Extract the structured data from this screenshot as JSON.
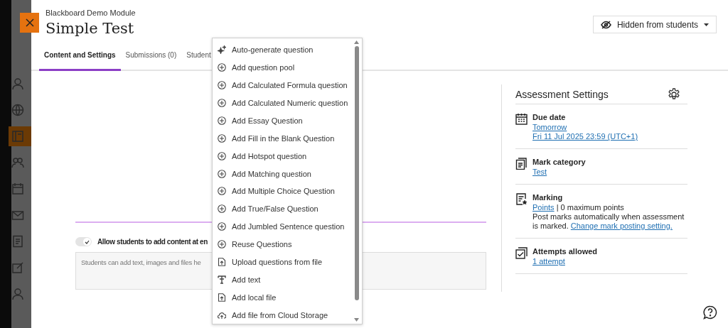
{
  "header": {
    "module": "Blackboard Demo Module",
    "title": "Simple Test",
    "visibility": "Hidden from students"
  },
  "tabs": [
    {
      "label": "Content and Settings",
      "selected": true
    },
    {
      "label": "Submissions (0)",
      "selected": false
    },
    {
      "label": "Student",
      "selected": false
    }
  ],
  "content": {
    "toggle": {
      "label": "Allow students to add content at en",
      "on": true
    },
    "textarea": {
      "placeholder": "Students can add text, images and files he"
    }
  },
  "settings": {
    "title": "Assessment Settings",
    "items": [
      {
        "kind": "calendar",
        "label": "Due date",
        "lines": [
          [
            {
              "text": "Tomorrow",
              "link": true
            }
          ],
          [
            {
              "text": "Fri 11 Jul 2025 23:59 (UTC+1)",
              "link": true
            }
          ]
        ]
      },
      {
        "kind": "category",
        "label": "Mark category",
        "lines": [
          [
            {
              "text": "Test",
              "link": true
            }
          ]
        ]
      },
      {
        "kind": "marking",
        "label": "Marking",
        "lines": [
          [
            {
              "text": "Points",
              "link": true
            },
            {
              "text": " | 0 maximum points",
              "link": false
            }
          ],
          [
            {
              "text": "Post marks automatically when assessment is marked. ",
              "link": false
            },
            {
              "text": "Change mark posting setting.",
              "link": true
            }
          ]
        ]
      },
      {
        "kind": "attempts",
        "label": "Attempts allowed",
        "lines": [
          [
            {
              "text": "1 attempt",
              "link": true
            }
          ]
        ]
      }
    ]
  },
  "menu": {
    "items": [
      {
        "kind": "generate",
        "label": "Auto-generate question"
      },
      {
        "kind": "add",
        "label": "Add question pool"
      },
      {
        "kind": "add",
        "label": "Add Calculated Formula question"
      },
      {
        "kind": "add",
        "label": "Add Calculated Numeric question"
      },
      {
        "kind": "add",
        "label": "Add Essay Question"
      },
      {
        "kind": "add",
        "label": "Add Fill in the Blank Question"
      },
      {
        "kind": "add",
        "label": "Add Hotspot question"
      },
      {
        "kind": "add",
        "label": "Add Matching question"
      },
      {
        "kind": "add",
        "label": "Add Multiple Choice Question"
      },
      {
        "kind": "add",
        "label": "Add True/False Question"
      },
      {
        "kind": "add",
        "label": "Add Jumbled Sentence question"
      },
      {
        "kind": "add",
        "label": "Reuse Questions"
      },
      {
        "kind": "upload",
        "label": "Upload questions from file"
      },
      {
        "kind": "text",
        "label": "Add text"
      },
      {
        "kind": "upload",
        "label": "Add local file"
      },
      {
        "kind": "cloud",
        "label": "Add file from Cloud Storage"
      }
    ]
  }
}
